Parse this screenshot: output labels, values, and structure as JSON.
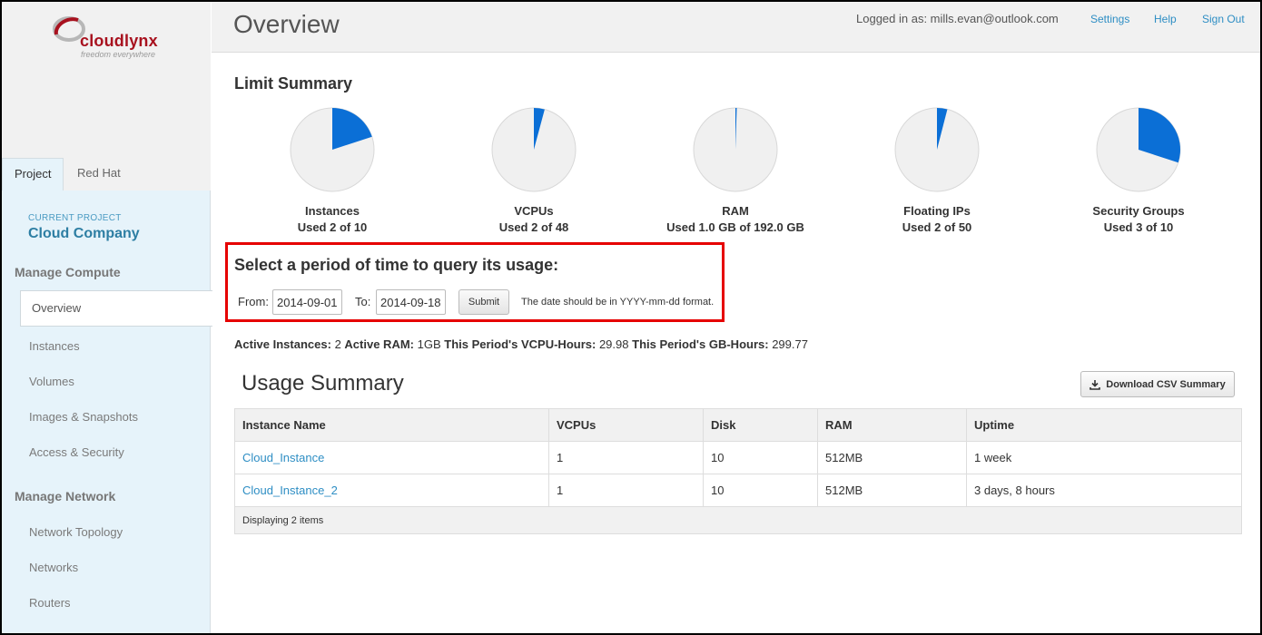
{
  "brand": {
    "name": "cloudlynx",
    "tagline": "freedom everywhere"
  },
  "sidebar": {
    "tabs": [
      {
        "label": "Project"
      },
      {
        "label": "Red Hat"
      }
    ],
    "current_project_label": "CURRENT PROJECT",
    "current_project_name": "Cloud Company",
    "sections": [
      {
        "title": "Manage Compute",
        "items": [
          "Overview",
          "Instances",
          "Volumes",
          "Images & Snapshots",
          "Access & Security"
        ]
      },
      {
        "title": "Manage Network",
        "items": [
          "Network Topology",
          "Networks",
          "Routers"
        ]
      }
    ]
  },
  "header": {
    "title": "Overview",
    "logged_in": "Logged in as: mills.evan@outlook.com",
    "links": [
      "Settings",
      "Help",
      "Sign Out"
    ]
  },
  "limit_summary": {
    "title": "Limit Summary",
    "colors": {
      "used": "#0b6fd6",
      "unused": "#f0f0f0"
    },
    "items": [
      {
        "name": "Instances",
        "used_text": "Used 2 of 10",
        "fraction": 0.2
      },
      {
        "name": "VCPUs",
        "used_text": "Used 2 of 48",
        "fraction": 0.0417
      },
      {
        "name": "RAM",
        "used_text": "Used 1.0 GB of 192.0 GB",
        "fraction": 0.0052
      },
      {
        "name": "Floating IPs",
        "used_text": "Used 2 of 50",
        "fraction": 0.04
      },
      {
        "name": "Security Groups",
        "used_text": "Used 3 of 10",
        "fraction": 0.3
      }
    ]
  },
  "query": {
    "title": "Select a period of time to query its usage:",
    "from_label": "From:",
    "from_value": "2014-09-01",
    "to_label": "To:",
    "to_value": "2014-09-18",
    "submit_label": "Submit",
    "hint": "The date should be in YYYY-mm-dd format."
  },
  "stats": {
    "active_instances_label": "Active Instances:",
    "active_instances": "2",
    "active_ram_label": "Active RAM:",
    "active_ram": "1GB",
    "vcpu_hours_label": "This Period's VCPU-Hours:",
    "vcpu_hours": "29.98",
    "gb_hours_label": "This Period's GB-Hours:",
    "gb_hours": "299.77"
  },
  "usage": {
    "title": "Usage Summary",
    "download_label": "Download CSV Summary",
    "columns": [
      "Instance Name",
      "VCPUs",
      "Disk",
      "RAM",
      "Uptime"
    ],
    "rows": [
      [
        "Cloud_Instance",
        "1",
        "10",
        "512MB",
        "1 week"
      ],
      [
        "Cloud_Instance_2",
        "1",
        "10",
        "512MB",
        "3 days, 8 hours"
      ]
    ],
    "footer": "Displaying 2 items"
  }
}
